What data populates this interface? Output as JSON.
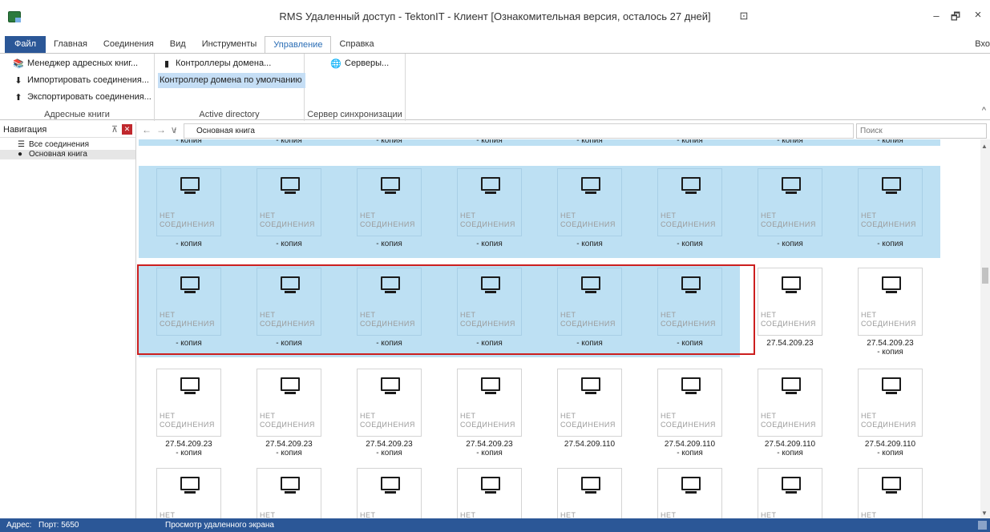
{
  "window": {
    "title": "RMS Удаленный доступ - TektonIT - Клиент [Ознакомительная версия, осталось 27 дней]",
    "controls": {
      "min": "–",
      "max": "🗗",
      "close": "×",
      "layout": "⊡"
    }
  },
  "tabs": [
    "Файл",
    "Главная",
    "Соединения",
    "Вид",
    "Инструменты",
    "Управление",
    "Справка"
  ],
  "active_tab": "Управление",
  "login": "Вхо",
  "ribbon": {
    "address_books": {
      "label": "Адресные книги",
      "items": [
        "Менеджер адресных книг...",
        "Импортировать соединения...",
        "Экспортировать соединения..."
      ]
    },
    "active_directory": {
      "label": "Active directory",
      "items": [
        "Контроллеры домена...",
        "Контроллер домена по умолчанию"
      ]
    },
    "sync_server": {
      "label": "Сервер синхронизации",
      "items": [
        "Серверы..."
      ]
    },
    "collapse": "^"
  },
  "nav": {
    "title": "Навигация",
    "pin": "⊼",
    "close": "✕",
    "items": [
      "Все соединения",
      "Основная книга"
    ]
  },
  "address_bar": {
    "back": "←",
    "forward": "→",
    "dropdown": "∨",
    "up": "↑",
    "path": "Основная книга",
    "search_placeholder": "Поиск"
  },
  "tile_status": "НЕТ\nСОЕДИНЕНИЯ",
  "top_partial_labels": [
    "- копия",
    "- копия",
    "- копия",
    "- копия",
    "- копия",
    "- копия",
    "- копия",
    "- копия"
  ],
  "rows": [
    {
      "labels": [
        "- копия",
        "- копия",
        "- копия",
        "- копия",
        "- копия",
        "- копия",
        "- копия",
        "- копия"
      ],
      "selected": [
        true,
        true,
        true,
        true,
        true,
        true,
        true,
        true
      ]
    },
    {
      "labels": [
        "- копия",
        "- копия",
        "- копия",
        "- копия",
        "- копия",
        "- копия",
        "27.54.209.23",
        "27.54.209.23\n- копия"
      ],
      "selected": [
        true,
        true,
        true,
        true,
        true,
        true,
        false,
        false
      ]
    },
    {
      "labels": [
        "27.54.209.23\n- копия",
        "27.54.209.23\n- копия",
        "27.54.209.23\n- копия",
        "27.54.209.23\n- копия",
        "27.54.209.110",
        "27.54.209.110\n- копия",
        "27.54.209.110\n- копия",
        "27.54.209.110\n- копия"
      ],
      "selected": [
        false,
        false,
        false,
        false,
        false,
        false,
        false,
        false
      ]
    },
    {
      "labels": [
        "",
        "",
        "",
        "",
        "",
        "",
        "",
        ""
      ],
      "selected": [
        false,
        false,
        false,
        false,
        false,
        false,
        false,
        false
      ]
    }
  ],
  "statusbar": {
    "address": "Адрес:",
    "port": "Порт: 5650",
    "mode": "Просмотр удаленного экрана"
  }
}
